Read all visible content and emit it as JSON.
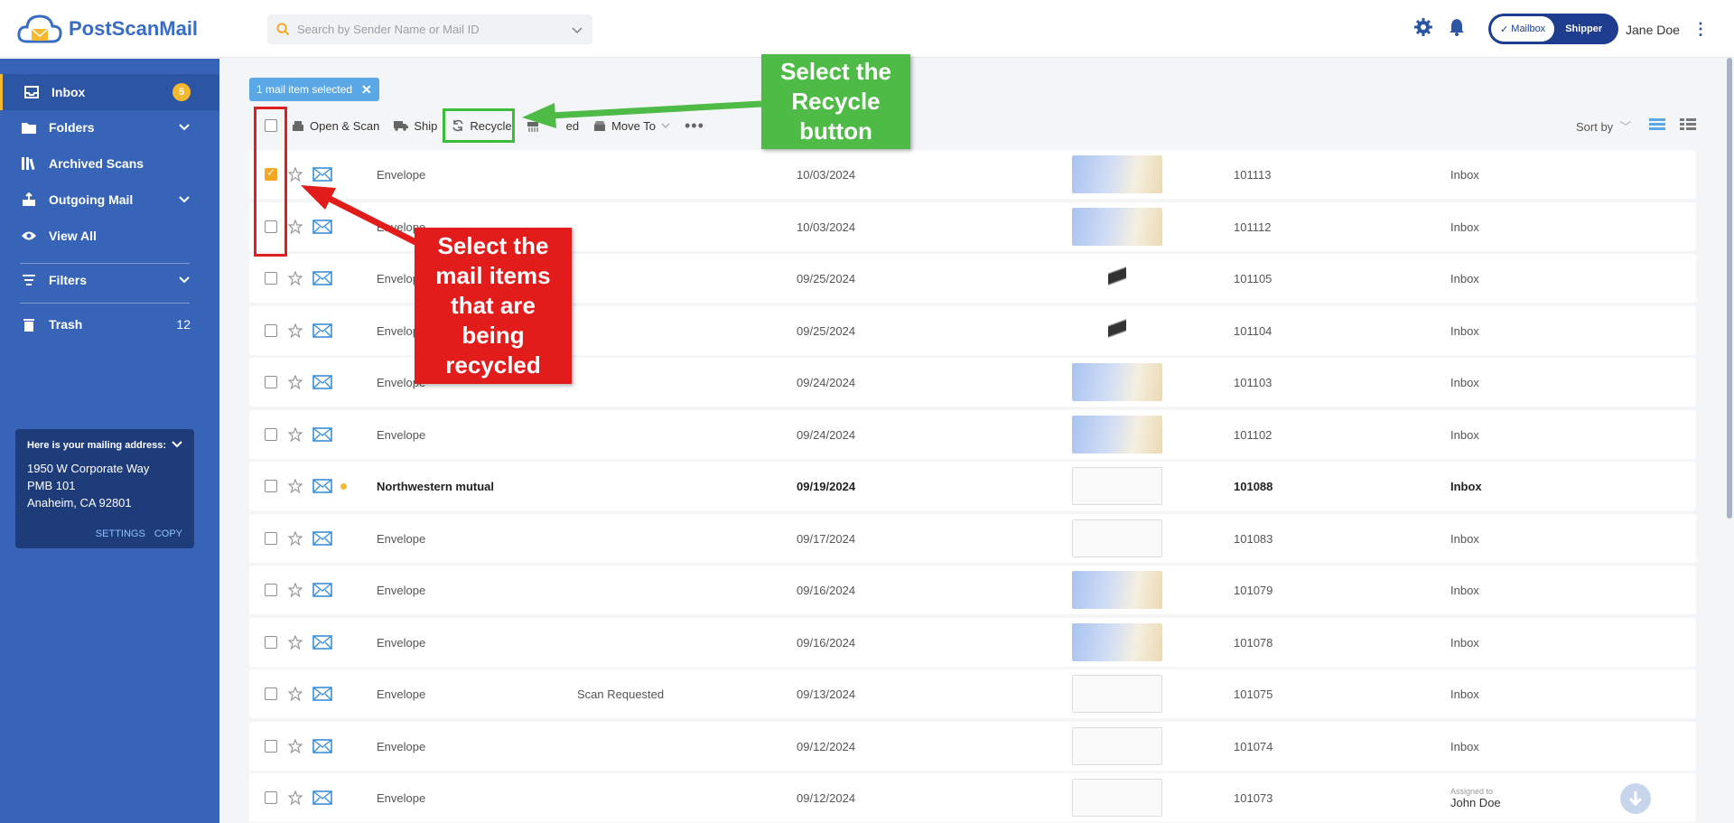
{
  "app": {
    "name": "PostScanMail"
  },
  "search": {
    "placeholder": "Search by Sender Name or Mail ID"
  },
  "header": {
    "toggle_on": "Mailbox",
    "toggle_off": "Shipper",
    "user_name": "Jane Doe"
  },
  "sidebar": {
    "items": [
      {
        "label": "Inbox",
        "badge": "5"
      },
      {
        "label": "Folders"
      },
      {
        "label": "Archived Scans"
      },
      {
        "label": "Outgoing Mail"
      },
      {
        "label": "View All"
      },
      {
        "label": "Filters"
      },
      {
        "label": "Trash",
        "count": "12"
      }
    ],
    "address": {
      "title": "Here is your mailing address:",
      "line1": "1950 W Corporate Way",
      "line2": "PMB 101",
      "line3": "Anaheim, CA 92801",
      "settings": "SETTINGS",
      "copy": "COPY"
    }
  },
  "selection": {
    "text": "1 mail item selected"
  },
  "toolbar": {
    "open_scan": "Open & Scan",
    "ship": "Ship",
    "recycle": "Recycle",
    "shred": "ed",
    "move_to": "Move To",
    "sort_by": "Sort by"
  },
  "rows": [
    {
      "sender": "Envelope",
      "status": "",
      "date": "10/03/2024",
      "thumb": "env",
      "id": "101113",
      "folder": "Inbox",
      "checked": true
    },
    {
      "sender": "Envelope",
      "status": "",
      "date": "10/03/2024",
      "thumb": "env",
      "id": "101112",
      "folder": "Inbox"
    },
    {
      "sender": "Envelope",
      "status": "",
      "date": "09/25/2024",
      "thumb": "pen",
      "id": "101105",
      "folder": "Inbox"
    },
    {
      "sender": "Envelope",
      "status": "",
      "date": "09/25/2024",
      "thumb": "pen",
      "id": "101104",
      "folder": "Inbox"
    },
    {
      "sender": "Envelope",
      "status": "",
      "date": "09/24/2024",
      "thumb": "env",
      "id": "101103",
      "folder": "Inbox"
    },
    {
      "sender": "Envelope",
      "status": "",
      "date": "09/24/2024",
      "thumb": "env",
      "id": "101102",
      "folder": "Inbox"
    },
    {
      "sender": "Northwestern mutual",
      "status": "",
      "date": "09/19/2024",
      "thumb": "white",
      "id": "101088",
      "folder": "Inbox",
      "unread": true
    },
    {
      "sender": "Envelope",
      "status": "",
      "date": "09/17/2024",
      "thumb": "white",
      "id": "101083",
      "folder": "Inbox"
    },
    {
      "sender": "Envelope",
      "status": "",
      "date": "09/16/2024",
      "thumb": "env",
      "id": "101079",
      "folder": "Inbox"
    },
    {
      "sender": "Envelope",
      "status": "",
      "date": "09/16/2024",
      "thumb": "env",
      "id": "101078",
      "folder": "Inbox"
    },
    {
      "sender": "Envelope",
      "status": "Scan Requested",
      "date": "09/13/2024",
      "thumb": "white",
      "id": "101075",
      "folder": "Inbox"
    },
    {
      "sender": "Envelope",
      "status": "",
      "date": "09/12/2024",
      "thumb": "white",
      "id": "101074",
      "folder": "Inbox"
    },
    {
      "sender": "Envelope",
      "status": "",
      "date": "09/12/2024",
      "thumb": "white",
      "id": "101073",
      "folder": "",
      "assigned_label": "Assigned to",
      "assigned_to": "John Doe"
    }
  ],
  "annotations": {
    "green_callout": "Select the Recycle button",
    "red_callout": "Select the mail items that are being recycled"
  }
}
